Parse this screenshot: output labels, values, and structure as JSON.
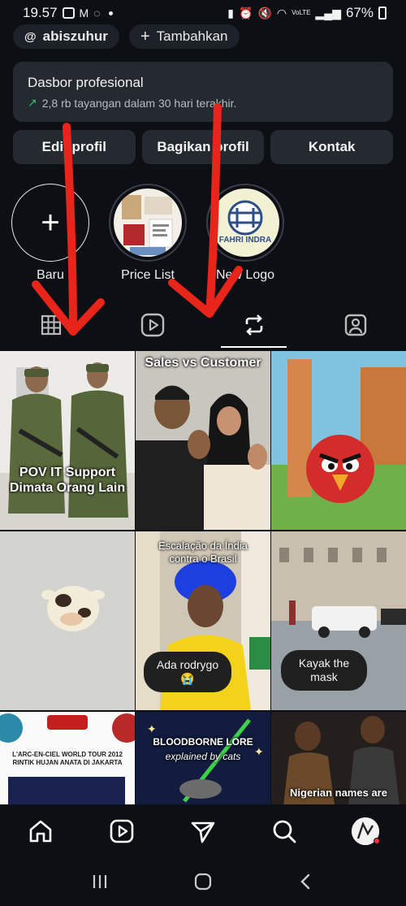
{
  "status_bar": {
    "time": "19.57",
    "battery": "67%",
    "volte": "VoLTE"
  },
  "chips": {
    "username": "abiszuhur",
    "add_label": "Tambahkan"
  },
  "dashboard": {
    "title": "Dasbor profesional",
    "subtitle": "2,8 rb tayangan dalam 30 hari terakhir."
  },
  "actions": {
    "edit": "Edit profil",
    "share": "Bagikan profil",
    "contact": "Kontak"
  },
  "highlights": [
    {
      "label": "Baru"
    },
    {
      "label": "Price List"
    },
    {
      "label": "New Logo",
      "logo_text": "FAHRI INDRA"
    }
  ],
  "tabs": {
    "active": "reposts",
    "items": [
      "grid-icon",
      "reels-icon",
      "repost-icon",
      "tagged-icon"
    ]
  },
  "posts": [
    {
      "caption": "POV IT Support\nDimata Orang Lain"
    },
    {
      "caption": "Sales vs Customer"
    },
    {
      "caption": ""
    },
    {
      "caption": ""
    },
    {
      "caption": "Escalação da Índia\ncontra o Brasil",
      "bubble": "Ada rodrygo\n😭"
    },
    {
      "caption": "",
      "bubble": "Kayak the\nmask"
    },
    {
      "caption": "L'ARC-EN-CIEL WORLD TOUR 2012\nRINTIK HUJAN ANATA DI JAKARTA"
    },
    {
      "caption": "BLOODBORNE LORE",
      "subcaption": "explained by cats"
    },
    {
      "caption": "Nigerian names are"
    }
  ],
  "colors": {
    "background": "#0c0f14",
    "card": "#252a31",
    "trend": "#2bc36b",
    "annotation_arrow": "#e8241b",
    "notification": "#ff3040"
  }
}
